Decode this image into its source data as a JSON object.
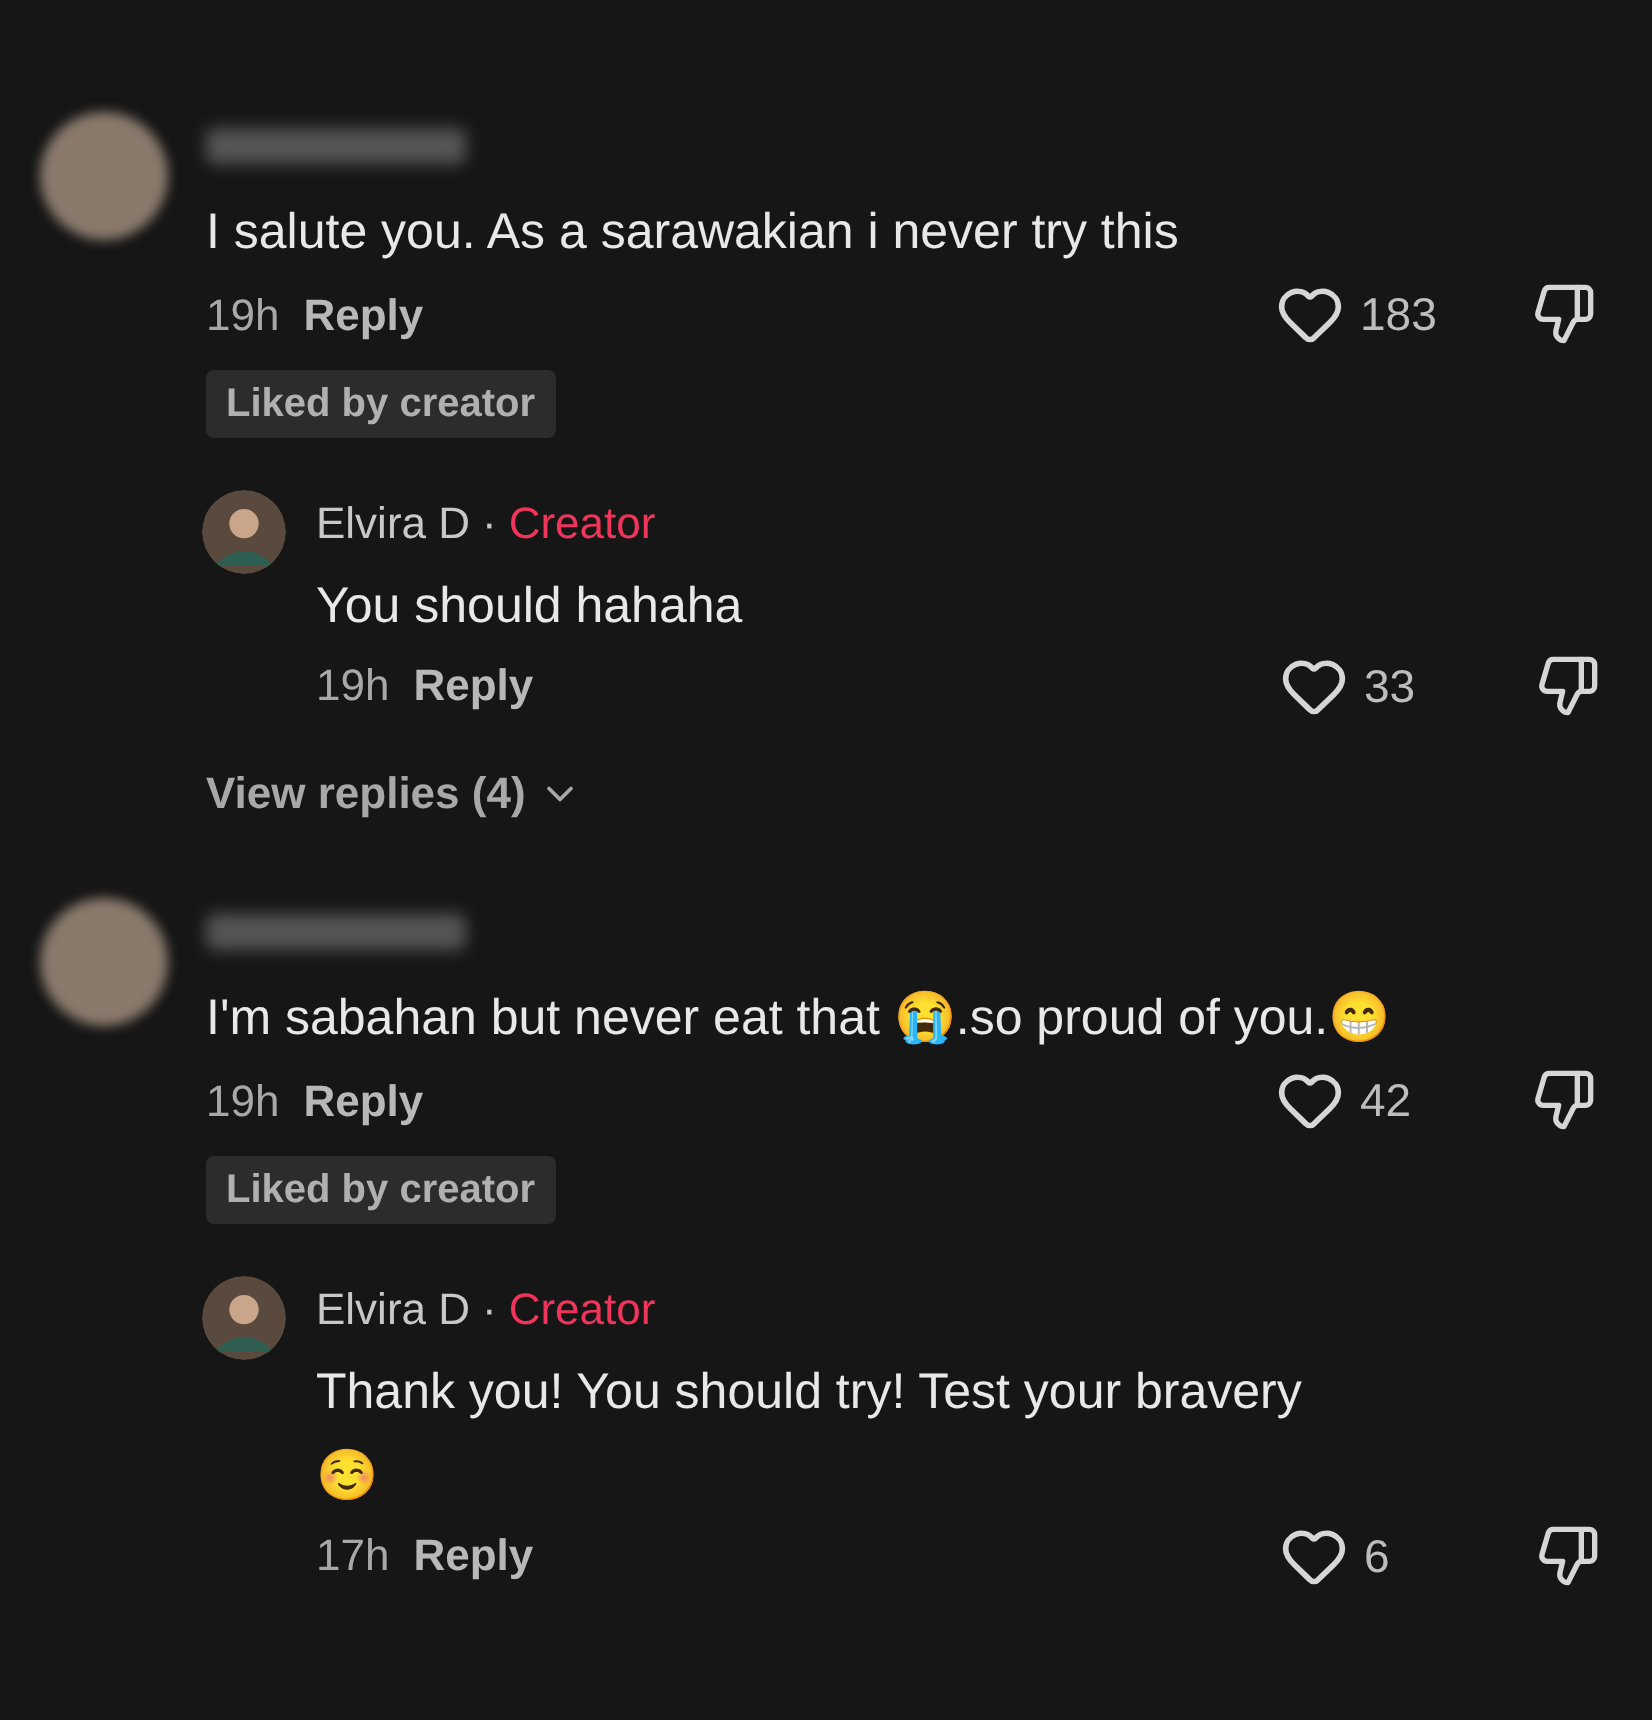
{
  "comments": [
    {
      "text": "I salute you. As a sarawakian i never try this",
      "time": "19h",
      "reply_label": "Reply",
      "likes": "183",
      "badge": "Liked by creator",
      "replies": [
        {
          "name": "Elvira D",
          "separator": "·",
          "role": "Creator",
          "text": "You should hahaha",
          "time": "19h",
          "reply_label": "Reply",
          "likes": "33"
        }
      ],
      "view_replies": "View replies (4)"
    },
    {
      "text": "I'm sabahan but never eat that 😭.so proud of you.😁",
      "time": "19h",
      "reply_label": "Reply",
      "likes": "42",
      "badge": "Liked by creator",
      "replies": [
        {
          "name": "Elvira D",
          "separator": "·",
          "role": "Creator",
          "text": "Thank you! You should try! Test your bravery ☺️",
          "time": "17h",
          "reply_label": "Reply",
          "likes": "6"
        }
      ]
    }
  ]
}
